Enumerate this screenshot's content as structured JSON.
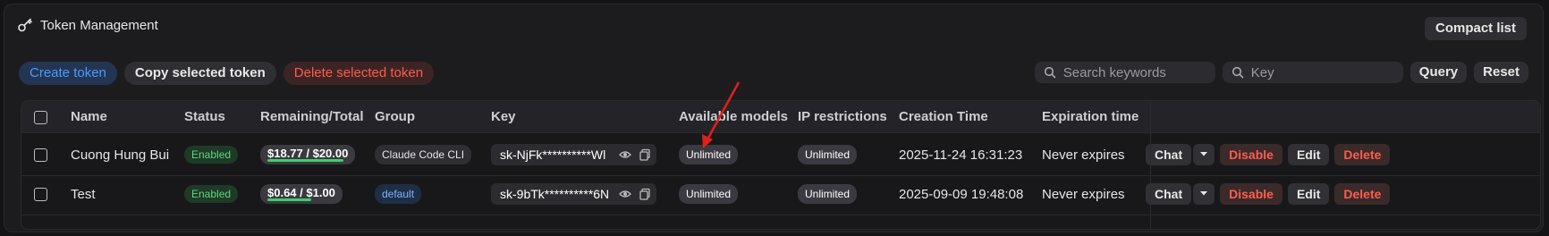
{
  "header": {
    "title": "Token Management",
    "compact_label": "Compact list"
  },
  "toolbar": {
    "create_label": "Create token",
    "copy_label": "Copy selected token",
    "delete_label": "Delete selected token",
    "search_placeholder": "Search keywords",
    "key_placeholder": "Key",
    "query_label": "Query",
    "reset_label": "Reset"
  },
  "columns": [
    "Name",
    "Status",
    "Remaining/Total",
    "Group",
    "Key",
    "Available models",
    "IP restrictions",
    "Creation Time",
    "Expiration time"
  ],
  "rows": [
    {
      "name": "Cuong Hung Bui",
      "status": "Enabled",
      "quota": "$18.77 / $20.00",
      "quota_fraction": 0.94,
      "group": "Claude Code CLI",
      "key": "sk-NjFk**********Wl",
      "models": "Unlimited",
      "ip": "Unlimited",
      "created": "2025-11-24 16:31:23",
      "expires": "Never expires"
    },
    {
      "name": "Test",
      "status": "Enabled",
      "quota": "$0.64 / $1.00",
      "quota_fraction": 0.64,
      "group": "default",
      "key": "sk-9bTk**********6N",
      "models": "Unlimited",
      "ip": "Unlimited",
      "created": "2025-09-09 19:48:08",
      "expires": "Never expires"
    }
  ],
  "actions": {
    "chat": "Chat",
    "disable": "Disable",
    "edit": "Edit",
    "delete": "Delete"
  },
  "colors": {
    "accent_blue": "#4a9cff",
    "danger": "#ff5c4d",
    "success": "#5ed57e",
    "annotation_arrow": "#e0201b"
  }
}
